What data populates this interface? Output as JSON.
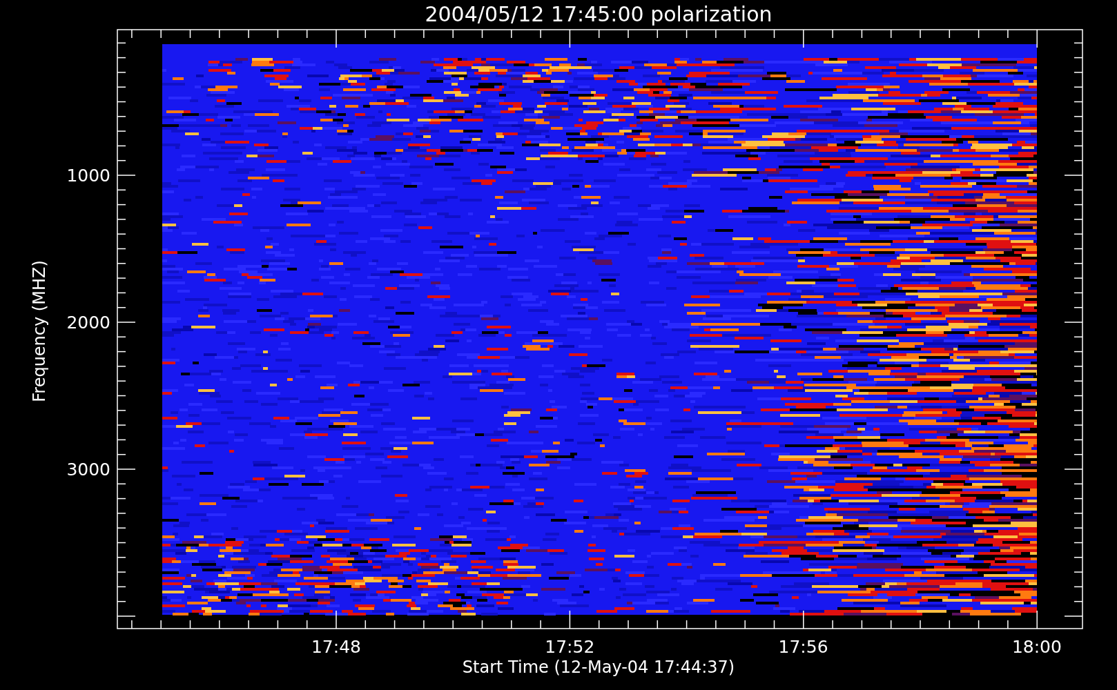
{
  "title": "2004/05/12 17:45:00 polarization",
  "y_axis": {
    "label": "Frequency (MHZ)",
    "ticks": [
      "1000",
      "2000",
      "3000"
    ]
  },
  "x_axis": {
    "label": "Start Time (12-May-04 17:44:37)",
    "ticks": [
      "17:48",
      "17:52",
      "17:56",
      "18:00"
    ]
  }
}
